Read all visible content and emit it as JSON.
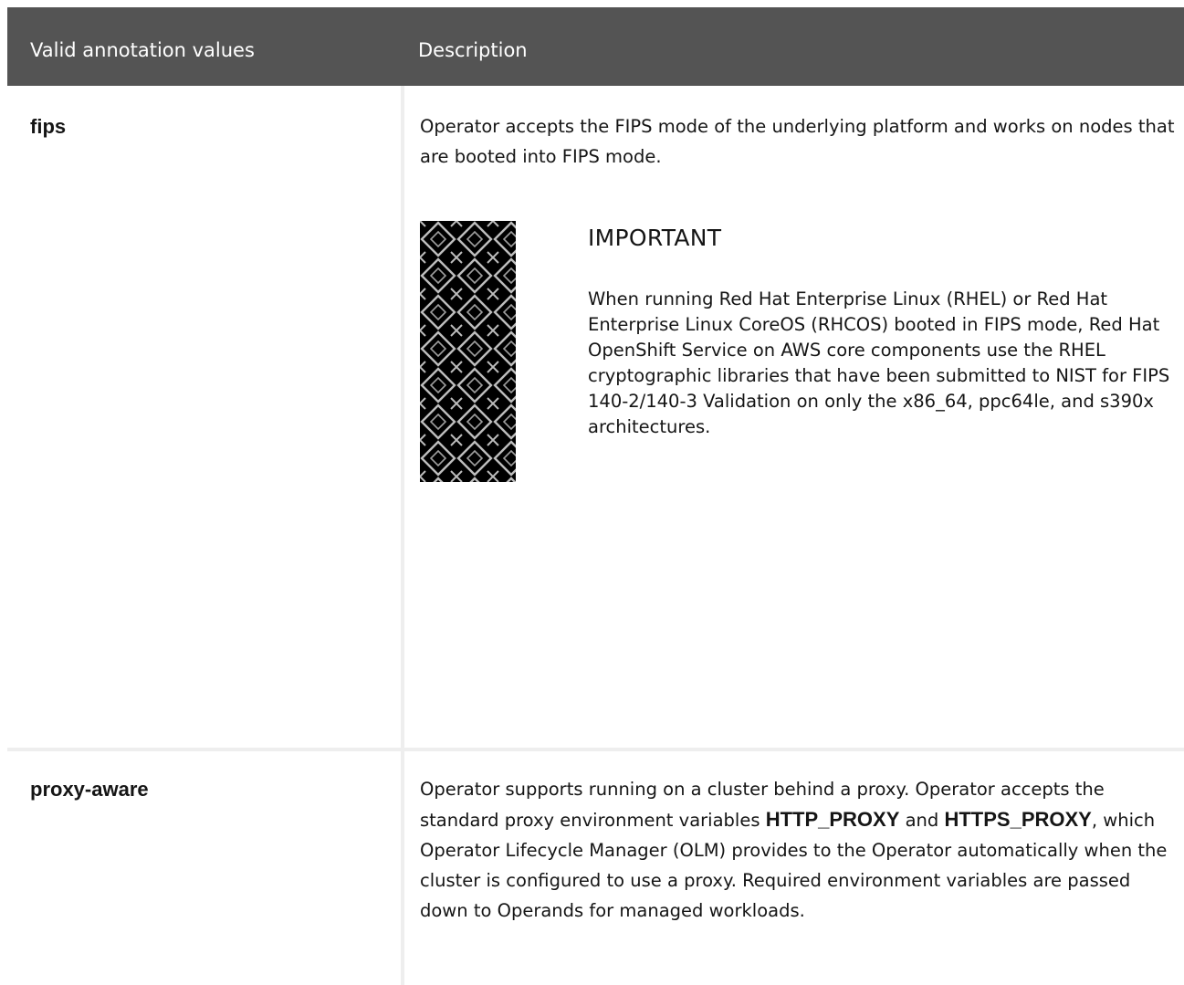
{
  "table": {
    "headers": {
      "values": "Valid annotation values",
      "description": "Description"
    },
    "rows": [
      {
        "value": "fips",
        "description": "Operator accepts the FIPS mode of the underlying platform and works on nodes that are booted into FIPS mode.",
        "admonition": {
          "icon": "red-hat-pattern-icon",
          "title": "IMPORTANT",
          "body": "When running Red Hat Enterprise Linux (RHEL) or Red Hat Enterprise Linux CoreOS (RHCOS) booted in FIPS mode, Red Hat OpenShift Service on AWS core components use the RHEL cryptographic libraries that have been submitted to NIST for FIPS 140-2/140-3 Validation on only the x86_64, ppc64le, and s390x architectures."
        }
      },
      {
        "value": "proxy-aware",
        "description_parts": {
          "p1": "Operator supports running on a cluster behind a proxy. Operator accepts the standard proxy environment variables ",
          "code1": "HTTP_PROXY",
          "p2": " and ",
          "code2": "HTTPS_PROXY",
          "p3": ", which Operator Lifecycle Manager (OLM) provides to the Operator automatically when the cluster is configured to use a proxy. Required environment variables are passed down to Operands for managed workloads."
        }
      }
    ]
  }
}
